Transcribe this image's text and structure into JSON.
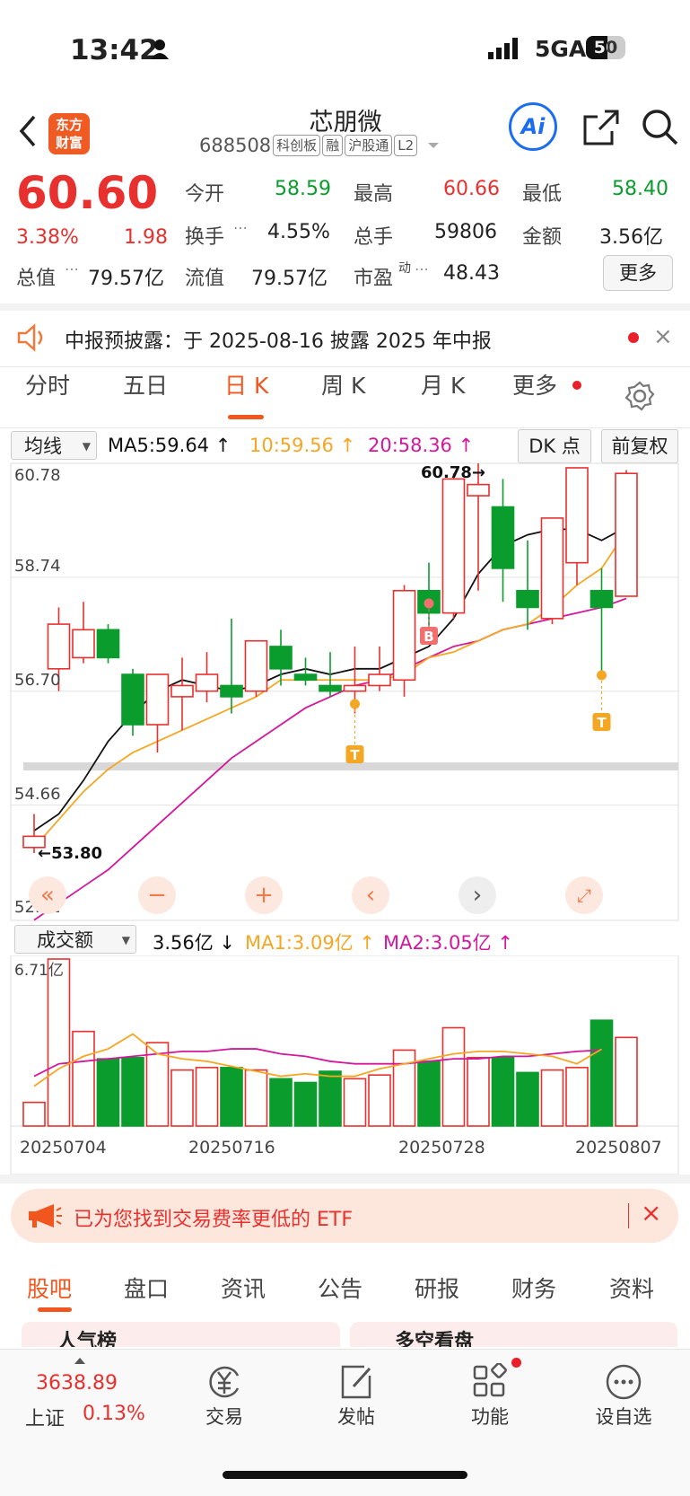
{
  "status_bar": {
    "time": "13:42",
    "network": "5GA",
    "battery": "50"
  },
  "header": {
    "app_logo_line1": "东方",
    "app_logo_line2": "财富",
    "stock_name": "芯朋微",
    "stock_code": "688508",
    "tags": [
      "科创板",
      "融",
      "沪股通",
      "L2"
    ],
    "ai_label": "Ai"
  },
  "quote": {
    "price": "60.60",
    "change_pct": "3.38%",
    "change_abs": "1.98",
    "open_label": "今开",
    "open": "58.59",
    "high_label": "最高",
    "high": "60.66",
    "low_label": "最低",
    "low": "58.40",
    "turnover_label": "换手",
    "turnover": "4.55%",
    "volume_label": "总手",
    "volume": "59806",
    "amount_label": "金额",
    "amount": "3.56亿",
    "mktcap_label": "总值",
    "mktcap": "79.57亿",
    "float_label": "流值",
    "float_cap": "79.57亿",
    "pe_label": "市盈",
    "pe_sup": "动",
    "pe": "48.43",
    "more_label": "更多"
  },
  "notice": {
    "text": "中报预披露：于 2025-08-16 披露 2025 年中报"
  },
  "tabs": [
    "分时",
    "五日",
    "日 K",
    "周 K",
    "月 K",
    "更多"
  ],
  "ma_bar": {
    "selector": "均线",
    "ma5": "MA5:59.64 ↑",
    "ma10": "10:59.56 ↑",
    "ma20": "20:58.36 ↑",
    "dk": "DK 点",
    "adjust": "前复权"
  },
  "chart_axis": {
    "y_labels": [
      "60.78",
      "58.74",
      "56.70",
      "54.66",
      "52.61"
    ],
    "high_note": "60.78→",
    "low_note": "←53.80",
    "buy_marker": "B",
    "t_marker": "T"
  },
  "vol_bar": {
    "selector": "成交额",
    "value": "3.56亿 ↓",
    "ma1": "MA1:3.09亿 ↑",
    "ma2": "MA2:3.05亿 ↑",
    "max_label": "6.71亿"
  },
  "x_dates": [
    "20250704",
    "20250716",
    "20250728",
    "20250807"
  ],
  "chart_data": {
    "type": "candlestick",
    "ylim": [
      52.61,
      60.78
    ],
    "candles": [
      {
        "o": 53.9,
        "h": 54.5,
        "l": 53.8,
        "c": 54.1
      },
      {
        "o": 57.1,
        "h": 58.2,
        "l": 56.7,
        "c": 57.9
      },
      {
        "o": 57.3,
        "h": 58.3,
        "l": 57.2,
        "c": 57.8
      },
      {
        "o": 57.8,
        "h": 57.9,
        "l": 57.2,
        "c": 57.3
      },
      {
        "o": 57.0,
        "h": 57.1,
        "l": 55.9,
        "c": 56.1
      },
      {
        "o": 56.1,
        "h": 57.0,
        "l": 55.6,
        "c": 57.0
      },
      {
        "o": 56.6,
        "h": 57.3,
        "l": 56.0,
        "c": 56.8
      },
      {
        "o": 56.7,
        "h": 57.4,
        "l": 56.5,
        "c": 57.0
      },
      {
        "o": 56.8,
        "h": 58.0,
        "l": 56.3,
        "c": 56.6
      },
      {
        "o": 56.7,
        "h": 57.5,
        "l": 56.6,
        "c": 57.6
      },
      {
        "o": 57.5,
        "h": 57.8,
        "l": 56.8,
        "c": 57.1
      },
      {
        "o": 57.0,
        "h": 57.3,
        "l": 56.8,
        "c": 56.9
      },
      {
        "o": 56.8,
        "h": 57.4,
        "l": 56.6,
        "c": 56.7
      },
      {
        "o": 56.7,
        "h": 57.5,
        "l": 56.3,
        "c": 56.8
      },
      {
        "o": 56.8,
        "h": 57.5,
        "l": 56.7,
        "c": 57.0
      },
      {
        "o": 56.9,
        "h": 58.6,
        "l": 56.6,
        "c": 58.5
      },
      {
        "o": 58.5,
        "h": 59.0,
        "l": 57.8,
        "c": 58.1
      },
      {
        "o": 58.1,
        "h": 60.6,
        "l": 58.0,
        "c": 60.5
      },
      {
        "o": 60.2,
        "h": 60.78,
        "l": 58.5,
        "c": 60.4
      },
      {
        "o": 60.0,
        "h": 60.5,
        "l": 58.3,
        "c": 58.9
      },
      {
        "o": 58.5,
        "h": 59.4,
        "l": 57.8,
        "c": 58.2
      },
      {
        "o": 58.0,
        "h": 59.1,
        "l": 57.9,
        "c": 59.8
      },
      {
        "o": 59.0,
        "h": 60.7,
        "l": 58.6,
        "c": 60.7
      },
      {
        "o": 58.5,
        "h": 58.9,
        "l": 56.9,
        "c": 58.2
      },
      {
        "o": 58.4,
        "h": 60.66,
        "l": 58.4,
        "c": 60.6
      }
    ],
    "ma5": [
      54.2,
      54.5,
      55.1,
      55.8,
      56.3,
      56.7,
      56.9,
      56.8,
      56.7,
      56.8,
      57.0,
      57.1,
      57.0,
      57.1,
      57.1,
      57.3,
      57.5,
      58.0,
      58.8,
      59.3,
      59.5,
      59.6,
      59.6,
      59.4,
      59.64
    ],
    "ma10": [
      53.9,
      54.4,
      54.9,
      55.3,
      55.6,
      55.8,
      56.0,
      56.2,
      56.4,
      56.6,
      56.9,
      56.9,
      56.9,
      56.9,
      56.9,
      57.0,
      57.3,
      57.4,
      57.6,
      57.8,
      57.9,
      58.2,
      58.6,
      58.9,
      59.56
    ],
    "ma20": [
      52.6,
      52.9,
      53.2,
      53.5,
      53.9,
      54.3,
      54.7,
      55.1,
      55.5,
      55.8,
      56.1,
      56.4,
      56.6,
      56.8,
      56.9,
      57.1,
      57.3,
      57.5,
      57.6,
      57.8,
      57.9,
      58.0,
      58.1,
      58.2,
      58.36
    ],
    "amount": [
      0.95,
      6.71,
      3.8,
      2.7,
      2.75,
      3.35,
      2.25,
      2.35,
      2.35,
      2.25,
      1.9,
      1.75,
      2.2,
      1.9,
      2.05,
      3.05,
      2.6,
      3.95,
      2.75,
      2.75,
      2.15,
      2.25,
      2.35,
      4.25,
      3.56
    ],
    "amount_ma1": [
      1.6,
      2.3,
      2.8,
      3.1,
      3.7,
      2.9,
      2.7,
      2.6,
      2.4,
      2.2,
      2.0,
      2.1,
      2.0,
      2.0,
      2.3,
      2.5,
      2.7,
      2.9,
      3.0,
      3.0,
      2.9,
      2.8,
      2.5,
      3.09
    ],
    "amount_ma2": [
      2.0,
      2.5,
      2.6,
      2.7,
      2.8,
      2.9,
      3.0,
      3.0,
      3.1,
      3.1,
      2.9,
      2.8,
      2.6,
      2.5,
      2.5,
      2.5,
      2.6,
      2.7,
      2.7,
      2.8,
      2.8,
      2.9,
      3.0,
      3.05
    ]
  },
  "etf_banner": {
    "text": "已为您找到交易费率更低的 ETF"
  },
  "bottom_tabs": [
    "股吧",
    "盘口",
    "资讯",
    "公告",
    "研报",
    "财务",
    "资料"
  ],
  "peek": {
    "left": "人气榜",
    "right": "多空看盘"
  },
  "dock": {
    "index_value": "3638.89",
    "index_name": "上证",
    "index_pct": "0.13%",
    "trade": "交易",
    "post": "发帖",
    "func": "功能",
    "watch": "设自选"
  }
}
